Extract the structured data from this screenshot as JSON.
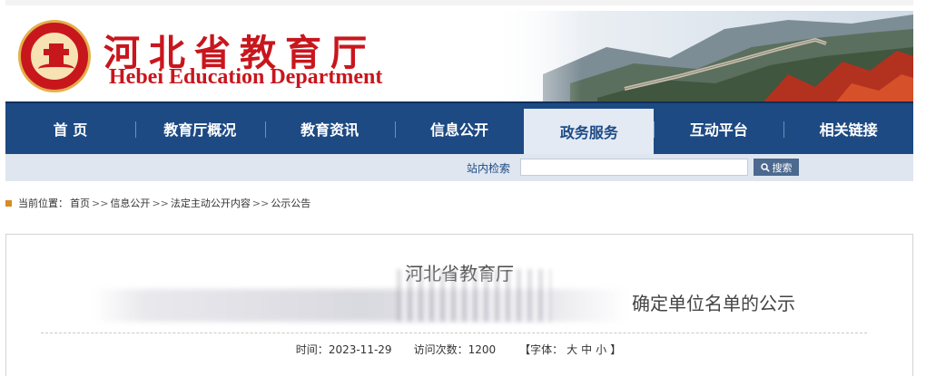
{
  "header": {
    "title_cn": "河北省教育厅",
    "title_en": "Hebei Education Department",
    "emblem_text": "Hebei Education Department"
  },
  "nav": {
    "items": [
      {
        "label": "首 页"
      },
      {
        "label": "教育厅概况"
      },
      {
        "label": "教育资讯"
      },
      {
        "label": "信息公开"
      },
      {
        "label": "政务服务"
      },
      {
        "label": "互动平台"
      },
      {
        "label": "相关链接"
      }
    ],
    "active_index": 4
  },
  "search": {
    "label": "站内检索",
    "value": "",
    "button_label": "搜索"
  },
  "breadcrumb": {
    "prefix": "当前位置：",
    "items": [
      "首页",
      "信息公开",
      "法定主动公开内容",
      "公示公告"
    ],
    "separator": ">>"
  },
  "article": {
    "title_line1": "河北省教育厅",
    "title_line2_visible": "确定单位名单的公示",
    "meta": {
      "time_label": "时间：",
      "time_value": "2023-11-29",
      "visits_label": "访问次数：",
      "visits_value": "1200",
      "font_label": "【字体：",
      "font_large": "大",
      "font_medium": "中",
      "font_small": "小",
      "font_close": "】"
    }
  },
  "colors": {
    "brand_red": "#c8161d",
    "nav_blue": "#1d4a83",
    "nav_active_bg": "#e3eaf4",
    "search_bar_bg": "#dfe6f0"
  }
}
